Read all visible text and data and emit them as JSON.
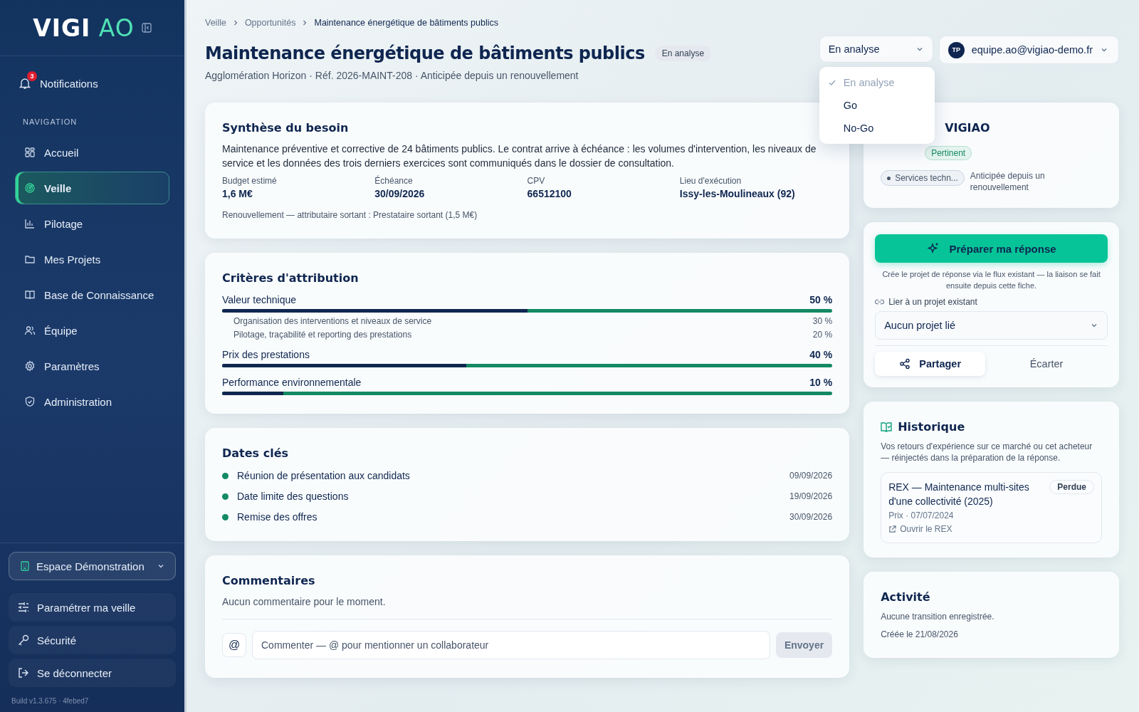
{
  "sidebar": {
    "logo": {
      "part1": "VIGI",
      "part2": "AO"
    },
    "notifications": {
      "label": "Notifications",
      "badge": "3"
    },
    "section_label": "NAVIGATION",
    "items": [
      {
        "label": "Accueil",
        "selected": false
      },
      {
        "label": "Veille",
        "selected": true
      },
      {
        "label": "Pilotage",
        "selected": false
      },
      {
        "label": "Mes Projets",
        "selected": false
      },
      {
        "label": "Base de Connaissance",
        "selected": false
      },
      {
        "label": "Équipe",
        "selected": false
      },
      {
        "label": "Paramètres",
        "selected": false
      },
      {
        "label": "Administration",
        "selected": false
      }
    ],
    "workspace": "Espace Démonstration",
    "footer_items": [
      "Paramétrer ma veille",
      "Sécurité",
      "Se déconnecter"
    ],
    "build": "Build v1.3.675 · 4febed7"
  },
  "header": {
    "breadcrumb": [
      "Veille",
      "Opportunités",
      "Maintenance énergétique de bâtiments publics"
    ],
    "title": "Maintenance énergétique de bâtiments publics",
    "status_badge": "En analyse",
    "subtitle": "Agglomération Horizon · Réf. 2026-MAINT-208 · Anticipée depuis un renouvellement",
    "status_select": {
      "value": "En analyse",
      "options": [
        {
          "label": "En analyse",
          "selected": true
        },
        {
          "label": "Go",
          "selected": false
        },
        {
          "label": "No-Go",
          "selected": false
        }
      ]
    },
    "user": {
      "initials": "TP",
      "email": "equipe.ao@vigiao-demo.fr"
    }
  },
  "needs": {
    "title": "Synthèse du besoin",
    "description": "Maintenance préventive et corrective de 24 bâtiments publics. Le contrat arrive à échéance : les volumes d'intervention, les niveaux de service et les données des trois derniers exercices sont communiqués dans le dossier de consultation.",
    "facts": [
      {
        "label": "Budget estimé",
        "value": "1,6 M€"
      },
      {
        "label": "Échéance",
        "value": "30/09/2026"
      },
      {
        "label": "CPV",
        "value": "66512100"
      },
      {
        "label": "Lieu d'exécution",
        "value": "Issy-les-Moulineaux (92)"
      }
    ],
    "note": "Renouvellement — attributaire sortant : Prestataire sortant (1,5 M€)"
  },
  "criteria": {
    "title": "Critères d'attribution",
    "items": [
      {
        "label": "Valeur technique",
        "value": "50 %",
        "level": 0.5,
        "subitems": [
          {
            "label": "Organisation des interventions et niveaux de service",
            "value": "30 %"
          },
          {
            "label": "Pilotage, traçabilité et reporting des prestations",
            "value": "20 %"
          }
        ]
      },
      {
        "label": "Prix des prestations",
        "value": "40 %",
        "level": 0.4
      },
      {
        "label": "Performance environnementale",
        "value": "10 %",
        "level": 0.1
      }
    ]
  },
  "dates": {
    "title": "Dates clés",
    "items": [
      {
        "label": "Réunion de présentation aux candidats",
        "date": "09/09/2026"
      },
      {
        "label": "Date limite des questions",
        "date": "19/09/2026"
      },
      {
        "label": "Remise des offres",
        "date": "30/09/2026"
      }
    ]
  },
  "comments": {
    "title": "Commentaires",
    "empty": "Aucun commentaire pour le moment.",
    "mention": "@",
    "placeholder": "Commenter — @ pour mentionner un collaborateur",
    "send": {
      "label": "Envoyer",
      "disabled": true
    }
  },
  "score": {
    "title": "VIGIAO",
    "badge": "Pertinent",
    "tag": "Services techn...",
    "note": "Anticipée depuis un renouvellement"
  },
  "actions": {
    "primary": "Préparer ma réponse",
    "help": "Crée le projet de réponse via le flux existant — la liaison se fait ensuite depuis cette fiche.",
    "link_label": "Lier à un projet existant",
    "project_select": "Aucun projet lié",
    "share": "Partager",
    "discard": "Écarter"
  },
  "history": {
    "title": "Historique",
    "description": "Vos retours d'expérience sur ce marché ou cet acheteur — réinjectés dans la préparation de la réponse.",
    "rex": {
      "title": "REX — Maintenance multi-sites d'une collectivité (2025)",
      "badge": "Perdue",
      "meta": "Prix · 07/07/2024",
      "link": "Ouvrir le REX"
    }
  },
  "activity": {
    "title": "Activité",
    "lines": [
      "Aucune transition enregistrée.",
      "Créée le 21/08/2026"
    ]
  }
}
